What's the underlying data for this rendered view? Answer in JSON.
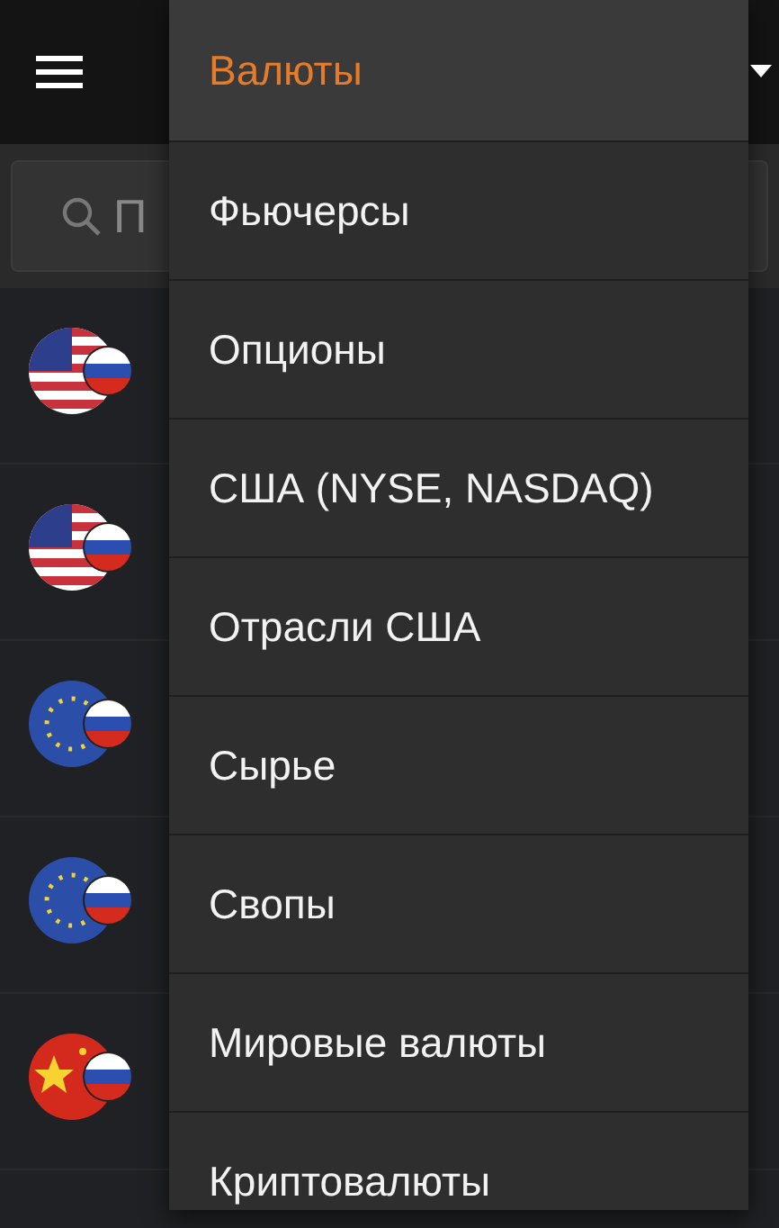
{
  "search": {
    "placeholder": "П"
  },
  "rows": [
    {
      "kind": "us"
    },
    {
      "kind": "us"
    },
    {
      "kind": "eu"
    },
    {
      "kind": "eu"
    },
    {
      "kind": "cn"
    }
  ],
  "menu": [
    {
      "label": "Валюты",
      "selected": true
    },
    {
      "label": "Фьючерсы",
      "selected": false
    },
    {
      "label": "Опционы",
      "selected": false
    },
    {
      "label": "США (NYSE, NASDAQ)",
      "selected": false
    },
    {
      "label": "Отрасли США",
      "selected": false
    },
    {
      "label": "Сырье",
      "selected": false
    },
    {
      "label": "Свопы",
      "selected": false
    },
    {
      "label": "Мировые валюты",
      "selected": false
    },
    {
      "label": "Криптовалюты",
      "selected": false
    }
  ]
}
